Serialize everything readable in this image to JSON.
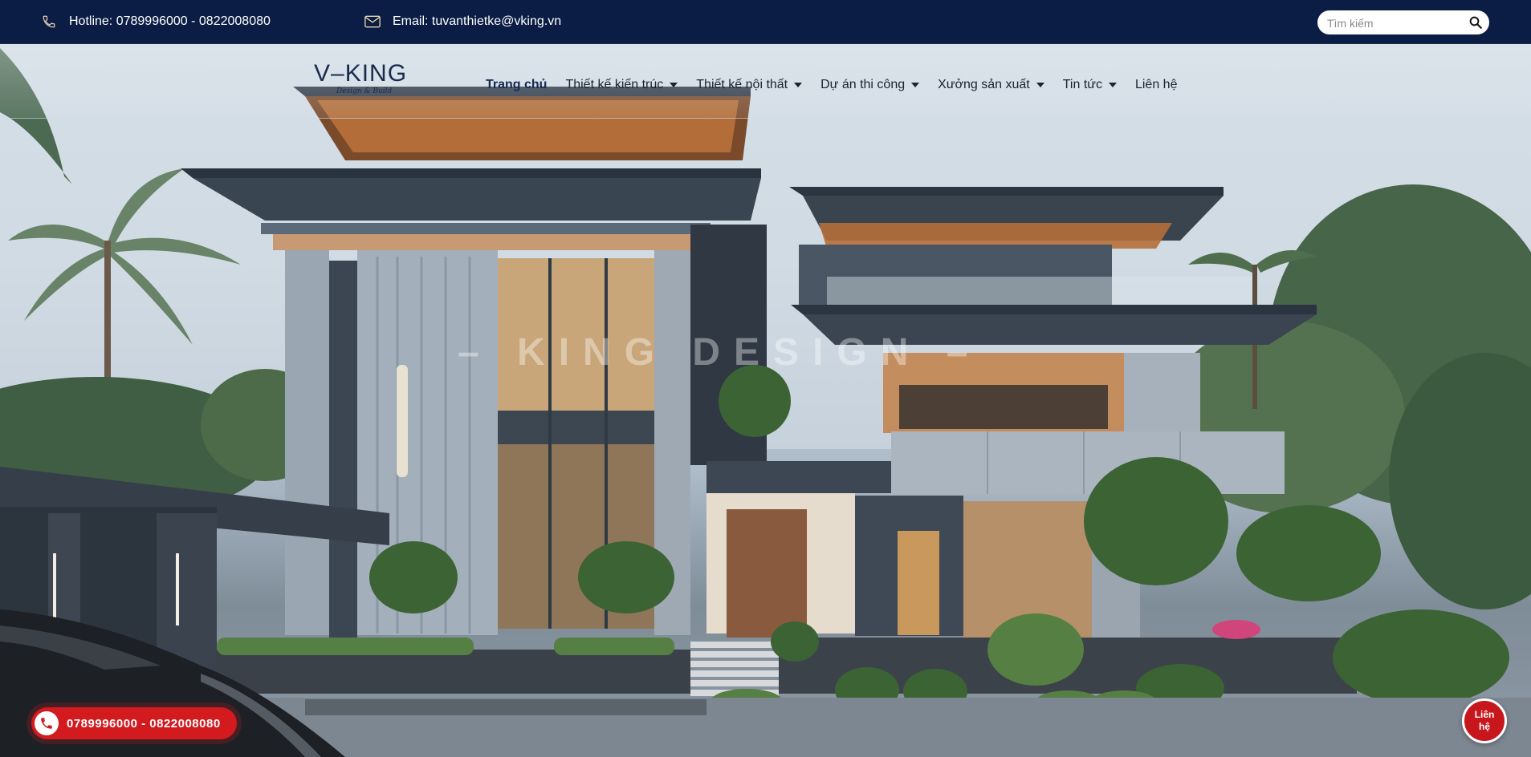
{
  "topbar": {
    "hotline": "Hotline: 0789996000 - 0822008080",
    "email": "Email: tuvanthietke@vking.vn",
    "search_placeholder": "Tìm kiếm",
    "icons": [
      "phone-icon",
      "mail-icon",
      "search-icon"
    ]
  },
  "logo": {
    "text": "V–KING",
    "subtitle": "Design & Build"
  },
  "nav": {
    "items": [
      {
        "label": "Trang chủ",
        "active": true,
        "has_dropdown": false
      },
      {
        "label": "Thiết kế kiến trúc",
        "active": false,
        "has_dropdown": true
      },
      {
        "label": "Thiết kế nội thất",
        "active": false,
        "has_dropdown": true
      },
      {
        "label": "Dự án thi công",
        "active": false,
        "has_dropdown": true
      },
      {
        "label": "Xưởng sản xuất",
        "active": false,
        "has_dropdown": true
      },
      {
        "label": "Tin tức",
        "active": false,
        "has_dropdown": true
      },
      {
        "label": "Liên hệ",
        "active": false,
        "has_dropdown": false
      }
    ]
  },
  "hero": {
    "watermark": "– KING DESIGN –"
  },
  "cta": {
    "call_label": "0789996000 - 0822008080",
    "contact_label": "Liên hệ"
  },
  "colors": {
    "topbar_bg": "#0b1d44",
    "nav_text": "#1b2230",
    "cta_red": "#d21a1f"
  }
}
